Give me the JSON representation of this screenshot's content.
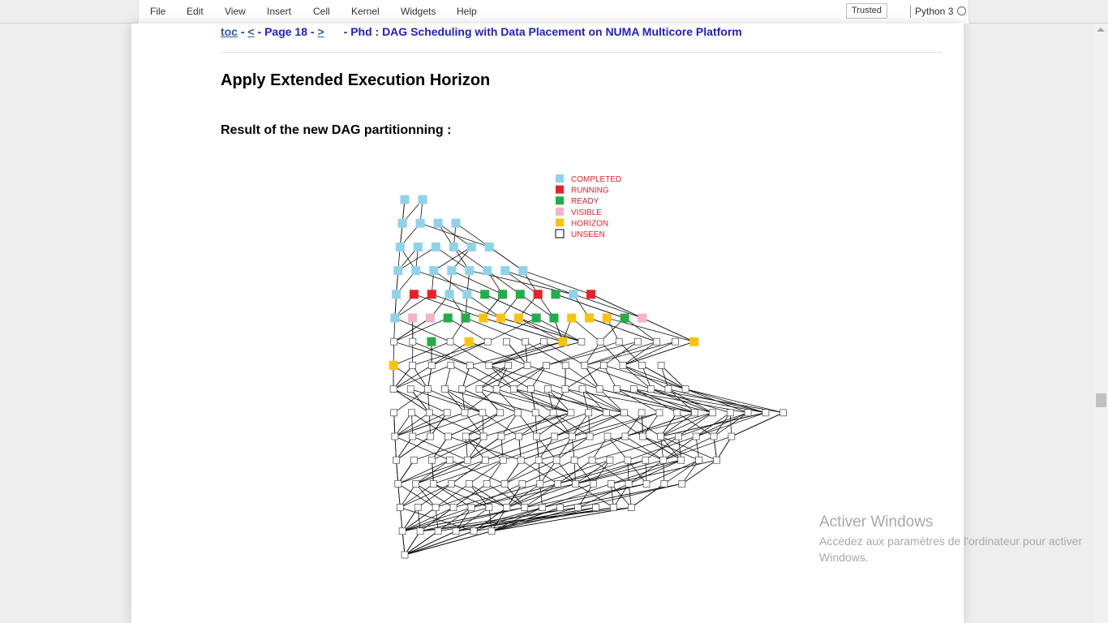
{
  "menu": {
    "file": "File",
    "edit": "Edit",
    "view": "View",
    "insert": "Insert",
    "cell": "Cell",
    "kernel": "Kernel",
    "widgets": "Widgets",
    "help": "Help"
  },
  "status": {
    "trusted": "Trusted",
    "kernel_name": "Python 3"
  },
  "nav": {
    "toc": "toc",
    "sep1": " - ",
    "prev": "<",
    "page": " - Page 18 - ",
    "next": ">",
    "title": "- Phd : DAG Scheduling with Data Placement on NUMA Multicore Platform"
  },
  "content": {
    "heading": "Apply Extended Execution Horizon",
    "subheading": "Result of the new DAG partitionning :"
  },
  "legend": [
    {
      "label": "COMPLETED",
      "color": "#8fd3e8"
    },
    {
      "label": "RUNNING",
      "color": "#e8202a"
    },
    {
      "label": "READY",
      "color": "#21ad4b"
    },
    {
      "label": "VISIBLE",
      "color": "#f5b3c8"
    },
    {
      "label": "HORIZON",
      "color": "#fdc20e"
    },
    {
      "label": "UNSEEN",
      "color": "#ffffff"
    }
  ],
  "dag_levels": [
    [
      "C",
      "C"
    ],
    [
      "C",
      "C",
      "C",
      "C"
    ],
    [
      "C",
      "C",
      "C",
      "C",
      "C",
      "C"
    ],
    [
      "C",
      "C",
      "C",
      "C",
      "C",
      "C",
      "C",
      "C"
    ],
    [
      "C",
      "R",
      "R",
      "C",
      "C",
      "G",
      "G",
      "G",
      "R",
      "G",
      "C",
      "R"
    ],
    [
      "C",
      "V",
      "V",
      "G",
      "G",
      "H",
      "H",
      "H",
      "G",
      "G",
      "H",
      "H",
      "H",
      "G",
      "V"
    ],
    [
      "U",
      "U",
      "G",
      "U",
      "H",
      "U",
      "U",
      "U",
      "U",
      "H",
      "U",
      "U",
      "U",
      "U",
      "U",
      "U",
      "H"
    ],
    [
      "H",
      "U",
      "U",
      "U",
      "U",
      "U",
      "U",
      "U",
      "U",
      "U",
      "U",
      "U",
      "U",
      "U",
      "U"
    ],
    [
      "U",
      "U",
      "U",
      "U",
      "U",
      "U",
      "U",
      "U",
      "U",
      "U",
      "U",
      "U",
      "U",
      "U",
      "U",
      "U",
      "U",
      "U"
    ],
    [
      "U",
      "U",
      "U",
      "U",
      "U",
      "U",
      "U",
      "U",
      "U",
      "U",
      "U",
      "U",
      "U",
      "U",
      "U",
      "U",
      "U",
      "U",
      "U",
      "U",
      "U",
      "U",
      "U"
    ],
    [
      "U",
      "U",
      "U",
      "U",
      "U",
      "U",
      "U",
      "U",
      "U",
      "U",
      "U",
      "U",
      "U",
      "U",
      "U",
      "U",
      "U",
      "U",
      "U",
      "U"
    ],
    [
      "U",
      "U",
      "U",
      "U",
      "U",
      "U",
      "U",
      "U",
      "U",
      "U",
      "U",
      "U",
      "U",
      "U",
      "U",
      "U",
      "U",
      "U",
      "U"
    ],
    [
      "U",
      "U",
      "U",
      "U",
      "U",
      "U",
      "U",
      "U",
      "U",
      "U",
      "U",
      "U",
      "U",
      "U",
      "U",
      "U",
      "U"
    ],
    [
      "U",
      "U",
      "U",
      "U",
      "U",
      "U",
      "U",
      "U",
      "U",
      "U",
      "U",
      "U",
      "U",
      "U"
    ],
    [
      "U",
      "U",
      "U",
      "U",
      "U",
      "U"
    ],
    [
      "U"
    ]
  ],
  "watermark": {
    "title": "Activer Windows",
    "message": "Accédez aux paramètres de l'ordinateur pour activer Windows."
  }
}
